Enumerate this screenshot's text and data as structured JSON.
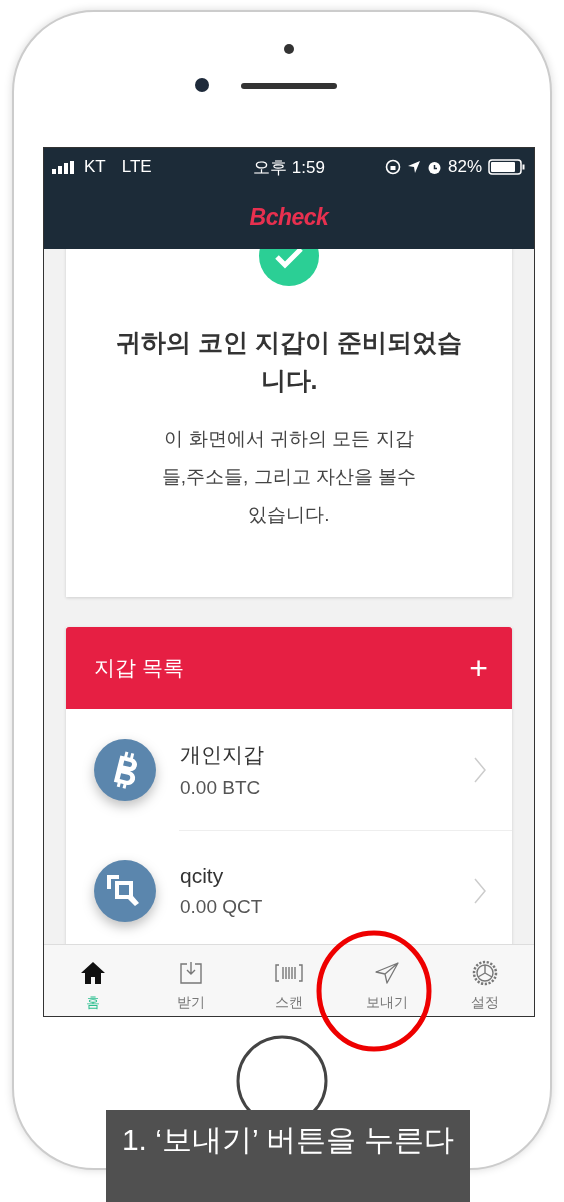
{
  "status_bar": {
    "carrier": "KT",
    "network": "LTE",
    "time": "오후 1:59",
    "battery": "82%"
  },
  "header": {
    "logo": "Bcheck"
  },
  "notice": {
    "title": "귀하의 코인 지갑이 준비되었습니다.",
    "message": "이 화면에서 귀하의 모든 지갑들,주소들, 그리고 자산을 볼수 있습니다."
  },
  "wallet_list": {
    "title": "지갑 목록",
    "add": "+",
    "items": [
      {
        "kind": "bitcoin",
        "name": "개인지갑",
        "balance": "0.00 BTC"
      },
      {
        "kind": "qcity",
        "name": "qcity",
        "balance": "0.00 QCT"
      }
    ]
  },
  "tabs": [
    {
      "kind": "home",
      "label": "홈",
      "selected": true
    },
    {
      "kind": "receive",
      "label": "받기",
      "selected": false
    },
    {
      "kind": "scan",
      "label": "스캔",
      "selected": false
    },
    {
      "kind": "send",
      "label": "보내기",
      "selected": false
    },
    {
      "kind": "settings",
      "label": "설정",
      "selected": false
    }
  ],
  "annotation": {
    "text": "1. ‘보내기’ 버튼을 누른다"
  }
}
